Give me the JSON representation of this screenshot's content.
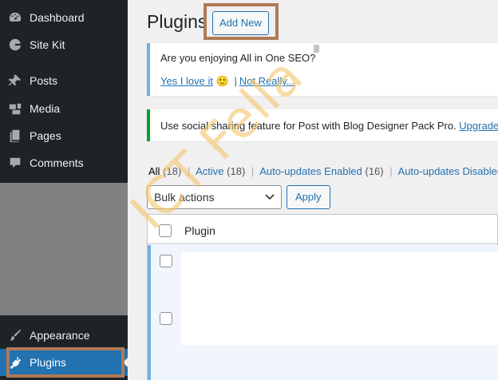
{
  "sidebar": {
    "items": [
      {
        "label": "Dashboard",
        "icon": "dashboard-icon"
      },
      {
        "label": "Site Kit",
        "icon": "site-kit-icon"
      },
      {
        "label": "Posts",
        "icon": "pin-icon"
      },
      {
        "label": "Media",
        "icon": "media-icon"
      },
      {
        "label": "Pages",
        "icon": "pages-icon"
      },
      {
        "label": "Comments",
        "icon": "comment-icon"
      },
      {
        "label": "Appearance",
        "icon": "brush-icon"
      },
      {
        "label": "Plugins",
        "icon": "plugin-icon"
      }
    ],
    "current": "Plugins"
  },
  "header": {
    "title": "Plugins",
    "add_new": "Add New"
  },
  "notices": {
    "seo": {
      "question": "Are you enjoying All in One SEO?",
      "yes": "Yes I love it",
      "emoji": "🙂",
      "separator": "|",
      "no": "Not Really..."
    },
    "blog": {
      "text": "Use social sharing feature for Post with Blog Designer Pack Pro.",
      "link": "Upgrade n"
    }
  },
  "filters": {
    "all": {
      "label": "All",
      "count": "(18)"
    },
    "active": {
      "label": "Active",
      "count": "(18)"
    },
    "auto_enabled": {
      "label": "Auto-updates Enabled",
      "count": "(16)"
    },
    "auto_disabled": {
      "label": "Auto-updates Disabled",
      "count": ""
    },
    "separator": "|"
  },
  "bulk": {
    "selected": "Bulk actions",
    "apply": "Apply"
  },
  "table": {
    "column": "Plugin"
  },
  "watermark": "ICT Fella",
  "colors": {
    "sidebar_bg": "#1d2327",
    "accent": "#2271b1",
    "highlight_border": "#b07a55",
    "watermark": "#f5c46a"
  }
}
